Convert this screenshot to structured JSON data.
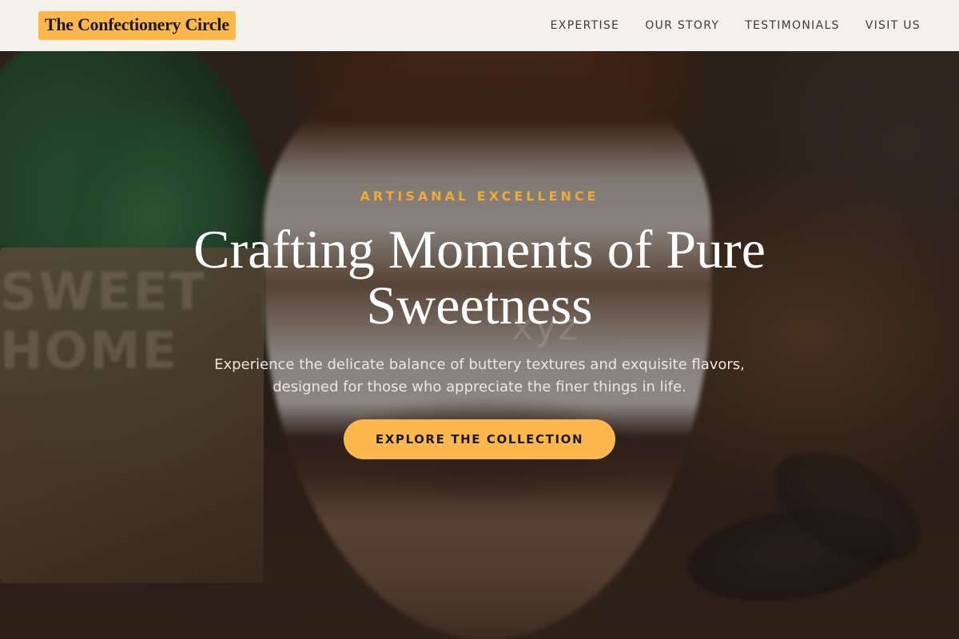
{
  "brand": {
    "name": "The Confectionery Circle"
  },
  "nav": {
    "items": [
      {
        "label": "EXPERTISE"
      },
      {
        "label": "OUR STORY"
      },
      {
        "label": "TESTIMONIALS"
      },
      {
        "label": "VISIT US"
      }
    ]
  },
  "hero": {
    "eyebrow": "ARTISANAL EXCELLENCE",
    "headline": "Crafting Moments of Pure Sweetness",
    "subtext": "Experience the delicate balance of buttery textures and exquisite flavors, designed for those who appreciate the finer things in life.",
    "cta_label": "EXPLORE THE COLLECTION",
    "watermark": "xyz",
    "sign_text": "SWEET HOME"
  },
  "colors": {
    "accent": "#fcb84d",
    "eyebrow": "#f0a936",
    "navbar_bg": "#f4f1ea",
    "nav_text": "#3d3b3a"
  }
}
